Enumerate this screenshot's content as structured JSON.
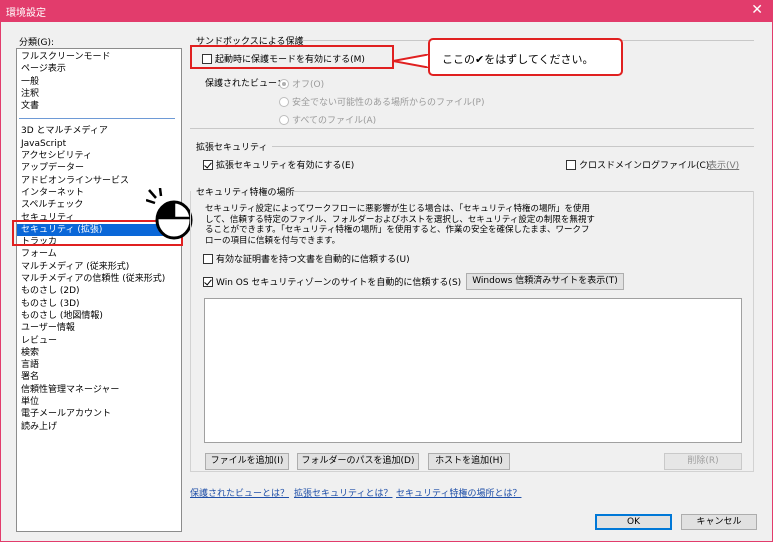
{
  "window": {
    "title": "環境設定",
    "close_glyph": "✕"
  },
  "categories": {
    "label": "分類(G):",
    "group1": [
      "フルスクリーンモード",
      "ページ表示",
      "一般",
      "注釈",
      "文書"
    ],
    "group2": [
      "3D とマルチメディア",
      "JavaScript",
      "アクセシビリティ",
      "アップデーター",
      "アドビオンラインサービス",
      "インターネット",
      "スペルチェック",
      "セキュリティ",
      "セキュリティ (拡張)",
      "トラッカ",
      "フォーム",
      "マルチメディア (従来形式)",
      "マルチメディアの信頼性 (従来形式)",
      "ものさし (2D)",
      "ものさし (3D)",
      "ものさし (地図情報)",
      "ユーザー情報",
      "レビュー",
      "検索",
      "言語",
      "署名",
      "信頼性管理マネージャー",
      "単位",
      "電子メールアカウント",
      "読み上げ"
    ],
    "selected": "セキュリティ (拡張)"
  },
  "sandbox": {
    "title": "サンドボックスによる保護",
    "enable_protected_mode": "起動時に保護モードを有効にする(M)",
    "protected_view_label": "保護されたビュー：",
    "options": [
      "オフ(O)",
      "安全でない可能性のある場所からのファイル(P)",
      "すべてのファイル(A)"
    ]
  },
  "callout": {
    "text": "ここの✔をはずしてください。"
  },
  "enhanced": {
    "title": "拡張セキュリティ",
    "enable": "拡張セキュリティを有効にする(E)",
    "cross_domain": "クロスドメインログファイル(C)",
    "view": "表示(V)"
  },
  "privileged": {
    "title": "セキュリティ特権の場所",
    "description": "セキュリティ設定によってワークフローに悪影響が生じる場合は、「セキュリティ特権の場所」を使用して、信頼する特定のファイル、フォルダーおよびホストを選択し、セキュリティ設定の制限を無視することができます。「セキュリティ特権の場所」を使用すると、作業の安全を確保したまま、ワークフローの項目に信頼を付与できます。",
    "trust_certified": "有効な証明書を持つ文書を自動的に信頼する(U)",
    "trust_winos": "Win OS セキュリティゾーンのサイトを自動的に信頼する(S)",
    "show_trusted_sites": "Windows 信頼済みサイトを表示(T)",
    "add_file": "ファイルを追加(I)",
    "add_folder": "フォルダーのパスを追加(D)",
    "add_host": "ホストを追加(H)",
    "remove": "削除(R)"
  },
  "links": [
    "保護されたビューとは？",
    "拡張セキュリティとは？",
    "セキュリティ特権の場所とは？"
  ],
  "footer": {
    "ok": "OK",
    "cancel": "キャンセル"
  }
}
